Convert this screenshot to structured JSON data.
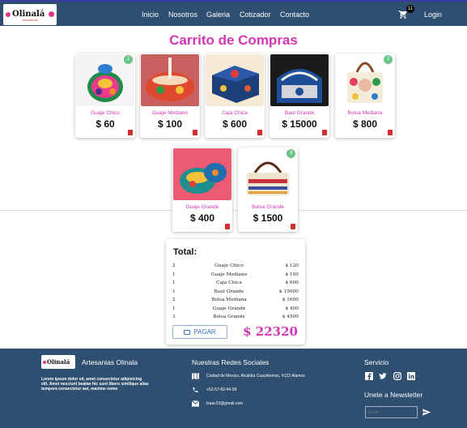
{
  "navbar": {
    "logo_text": "Olinalá",
    "logo_sub": "artesanías",
    "links": [
      "Inicio",
      "Nosotros",
      "Galeria",
      "Cotizador",
      "Contacto"
    ],
    "cart_count": "11",
    "login": "Login"
  },
  "page_title": "Carrito de Compras",
  "products": [
    {
      "name": "Guaje Chico",
      "price": "$ 60",
      "qty": "2"
    },
    {
      "name": "Guaje Mediano",
      "price": "$ 100",
      "qty": ""
    },
    {
      "name": "Caja Chica",
      "price": "$ 600",
      "qty": ""
    },
    {
      "name": "Baul Grande",
      "price": "$ 15000",
      "qty": ""
    },
    {
      "name": "Bolsa Mediana",
      "price": "$ 800",
      "qty": "2"
    },
    {
      "name": "Guaje Grande",
      "price": "$ 400",
      "qty": ""
    },
    {
      "name": "Bolsa Grande",
      "price": "$ 1500",
      "qty": "3"
    }
  ],
  "summary": {
    "title": "Total:",
    "rows": [
      {
        "qty": "2",
        "name": "Guaje Chico",
        "price": "$ 120"
      },
      {
        "qty": "1",
        "name": "Guaje Mediano",
        "price": "$ 100"
      },
      {
        "qty": "1",
        "name": "Caja Chica",
        "price": "$ 600"
      },
      {
        "qty": "1",
        "name": "Baul Grande",
        "price": "$ 15000"
      },
      {
        "qty": "2",
        "name": "Bolsa Mediana",
        "price": "$ 1600"
      },
      {
        "qty": "1",
        "name": "Guaje Grande",
        "price": "$ 400"
      },
      {
        "qty": "3",
        "name": "Bolsa Grande",
        "price": "$ 4500"
      }
    ],
    "pay_label": "PAGAR",
    "grand_total": "$ 22320"
  },
  "footer": {
    "logo_text": "Olinalá",
    "brand": "Artesanias Olinala",
    "lorem": "Lorem ipsum dolor sit, amet consectetur adipisicing elit. Amet nesciunt beatae hic sunt libero similique alias tempora consectetur aut, maxime nemo",
    "social_title": "Nuestras Redes Sociales",
    "address": "Ciudad de Mexico, Alcaldía Cuauhtemoc, #123 Alamos",
    "phone": "+52-57-82-44-99",
    "email": "lsaac23@gmail.com",
    "service_title": "Servicio",
    "newsletter_title": "Unete a Newsletter",
    "email_placeholder": "Email"
  },
  "colors": {
    "navbar": "#2e4f6f",
    "accent": "#d336b4",
    "badge": "#6bc38a",
    "trash": "#d32f2f"
  }
}
